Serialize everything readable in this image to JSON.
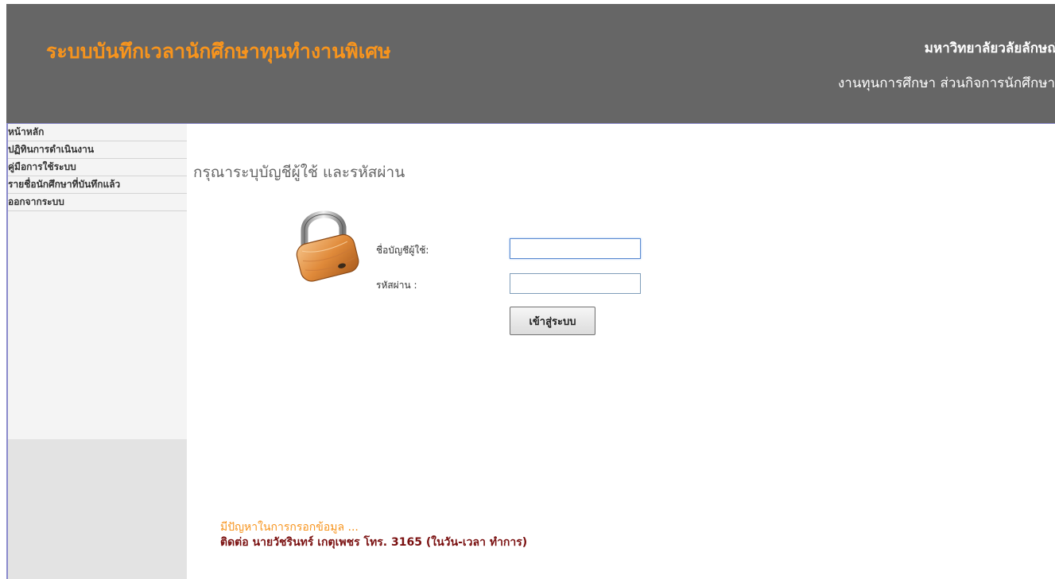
{
  "header": {
    "title": "ระบบบันทึกเวลานักศึกษาทุนทำงานพิเศษ",
    "org_line1": "มหาวิทยาลัยวลัยลักษณ์",
    "org_line2": "งานทุนการศึกษา ส่วนกิจการนักศึกษา"
  },
  "sidebar": {
    "items": [
      {
        "label": "หน้าหลัก"
      },
      {
        "label": "ปฏิทินการดำเนินงาน"
      },
      {
        "label": "คู่มือการใช้ระบบ"
      },
      {
        "label": "รายชื่อนักศึกษาที่บันทึกแล้ว"
      },
      {
        "label": "ออกจากระบบ"
      }
    ]
  },
  "login": {
    "prompt": "กรุณาระบุบัญชีผู้ใช้ และรหัสผ่าน",
    "username_label": "ชื่อบัญชีผู้ใช้:",
    "username_value": "",
    "password_label": "รหัสผ่าน :",
    "password_value": "",
    "submit_label": "เข้าสู่ระบบ",
    "icon": "padlock-icon"
  },
  "help": {
    "line1": "มีปัญหาในการกรอกข้อมูล ...",
    "line2": "ติดต่อ นายวัชรินทร์ เกตุเพชร โทร. 3165 (ในวัน-เวลา ทำการ)"
  },
  "colors": {
    "accent": "#f7941d",
    "header_bg": "#666666",
    "contact_text": "#7a1010"
  }
}
